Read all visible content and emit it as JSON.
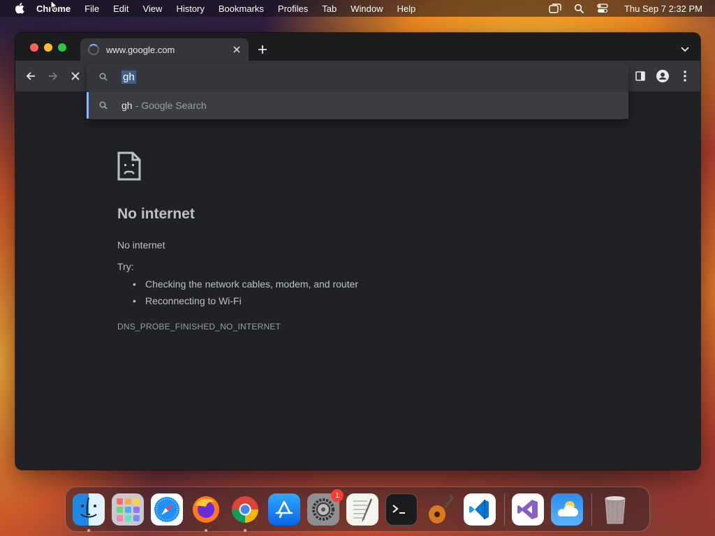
{
  "menubar": {
    "app_name": "Chrome",
    "items": [
      "File",
      "Edit",
      "View",
      "History",
      "Bookmarks",
      "Profiles",
      "Tab",
      "Window",
      "Help"
    ],
    "status_icons": [
      "screen-mirroring-icon",
      "spotlight-search-icon",
      "control-center-icon"
    ],
    "clock": "Thu Sep 7  2:32 PM"
  },
  "browser": {
    "tab": {
      "title": "www.google.com",
      "loading": true
    },
    "omnibox": {
      "value": "gh",
      "suggestion": {
        "query": "gh",
        "separator": "-",
        "description": "Google Search"
      }
    }
  },
  "error_page": {
    "title": "No internet",
    "message": "No internet",
    "try_label": "Try:",
    "suggestions": [
      "Checking the network cables, modem, and router",
      "Reconnecting to Wi-Fi"
    ],
    "code": "DNS_PROBE_FINISHED_NO_INTERNET"
  },
  "dock": {
    "apps": [
      {
        "name": "Finder",
        "running": true
      },
      {
        "name": "Launchpad",
        "running": false
      },
      {
        "name": "Safari",
        "running": false
      },
      {
        "name": "Firefox",
        "running": true
      },
      {
        "name": "Google Chrome",
        "running": true
      },
      {
        "name": "App Store",
        "running": false
      },
      {
        "name": "System Settings",
        "running": false,
        "badge": "1"
      },
      {
        "name": "TextEdit",
        "running": false
      },
      {
        "name": "Terminal",
        "running": false
      },
      {
        "name": "GarageBand",
        "running": false
      },
      {
        "name": "Visual Studio Code",
        "running": false
      },
      {
        "name": "Visual Studio",
        "running": false
      },
      {
        "name": "Weather",
        "running": false
      },
      {
        "name": "Trash",
        "running": false
      }
    ]
  },
  "colors": {
    "window_bg": "#202124",
    "toolbar_bg": "#35363a",
    "accent_blue": "#8ab4f8",
    "text_primary": "#e8eaed",
    "text_secondary": "#bdc1c6",
    "badge_red": "#ff3b30"
  }
}
